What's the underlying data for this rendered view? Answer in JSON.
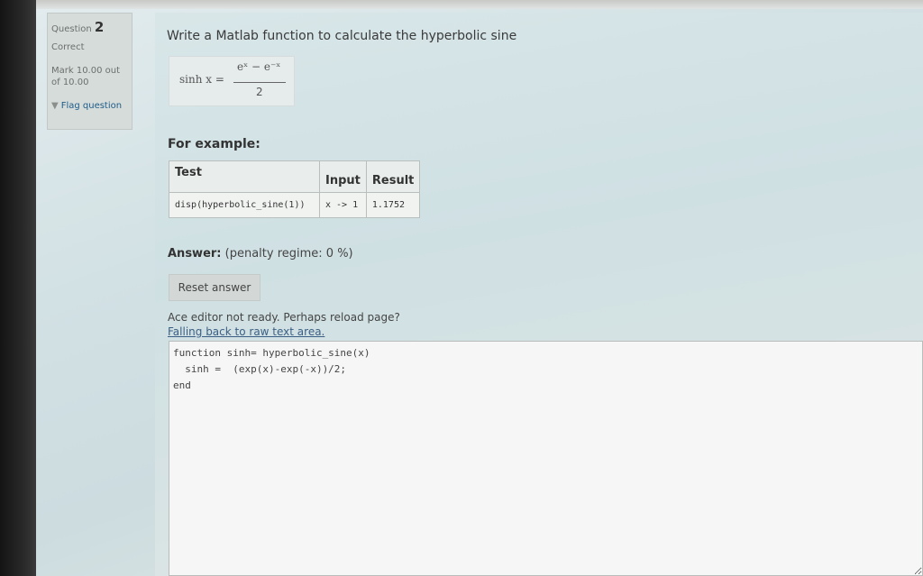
{
  "info": {
    "question_label": "Question",
    "question_number": "2",
    "state": "Correct",
    "grade_line1": "Mark 10.00 out",
    "grade_line2": "of 10.00",
    "flag_label": "Flag question"
  },
  "question": {
    "text": "Write a Matlab function to calculate the hyperbolic sine",
    "formula": {
      "lhs": "sinh x =",
      "numerator": "eˣ − e⁻ˣ",
      "denominator": "2"
    }
  },
  "example": {
    "heading": "For example:",
    "headers": [
      "Test",
      "Input",
      "Result"
    ],
    "rows": [
      [
        "disp(hyperbolic_sine(1))",
        "x -> 1",
        "1.1752"
      ]
    ]
  },
  "answer": {
    "label": "Answer:",
    "penalty": "(penalty regime: 0 %)",
    "reset_label": "Reset answer",
    "ace_msg_line1": "Ace editor not ready. Perhaps reload page?",
    "ace_msg_line2": "Falling back to raw text area.",
    "code": "function sinh= hyperbolic_sine(x)\n  sinh =  (exp(x)-exp(-x))/2;\nend"
  }
}
